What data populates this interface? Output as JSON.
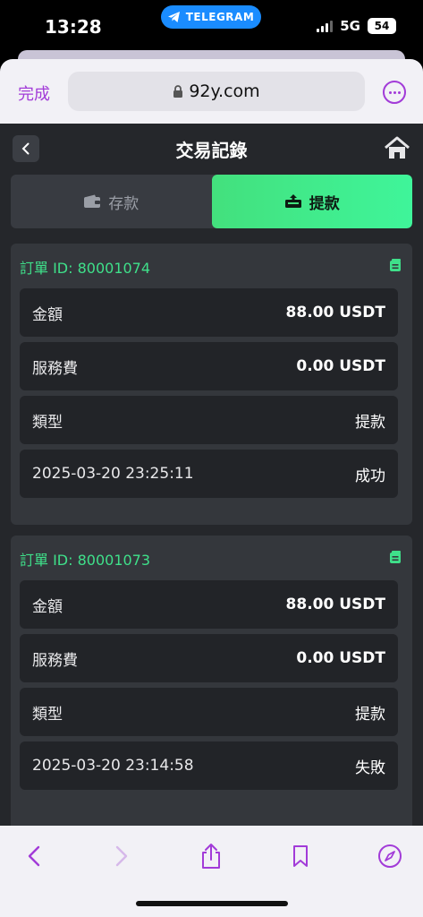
{
  "status_bar": {
    "time": "13:28",
    "pill_app": "TELEGRAM",
    "network": "5G",
    "battery": "54"
  },
  "browser": {
    "done_label": "完成",
    "url": "92y.com"
  },
  "app": {
    "title": "交易記錄",
    "tabs": [
      {
        "label": "存款",
        "active": false
      },
      {
        "label": "提款",
        "active": true
      }
    ],
    "orders": [
      {
        "order_id": "訂單 ID: 80001074",
        "rows": [
          {
            "label": "金額",
            "value": "88.00 USDT"
          },
          {
            "label": "服務費",
            "value": "0.00 USDT"
          },
          {
            "label": "類型",
            "value": "提款"
          },
          {
            "label": "2025-03-20 23:25:11",
            "value": "成功"
          }
        ]
      },
      {
        "order_id": "訂單 ID: 80001073",
        "rows": [
          {
            "label": "金額",
            "value": "88.00 USDT"
          },
          {
            "label": "服務費",
            "value": "0.00 USDT"
          },
          {
            "label": "類型",
            "value": "提款"
          },
          {
            "label": "2025-03-20 23:14:58",
            "value": "失敗"
          }
        ]
      }
    ]
  },
  "colors": {
    "accent_purple": "#a23bd8",
    "accent_green": "#3fe08a",
    "app_bg": "#25272b"
  }
}
